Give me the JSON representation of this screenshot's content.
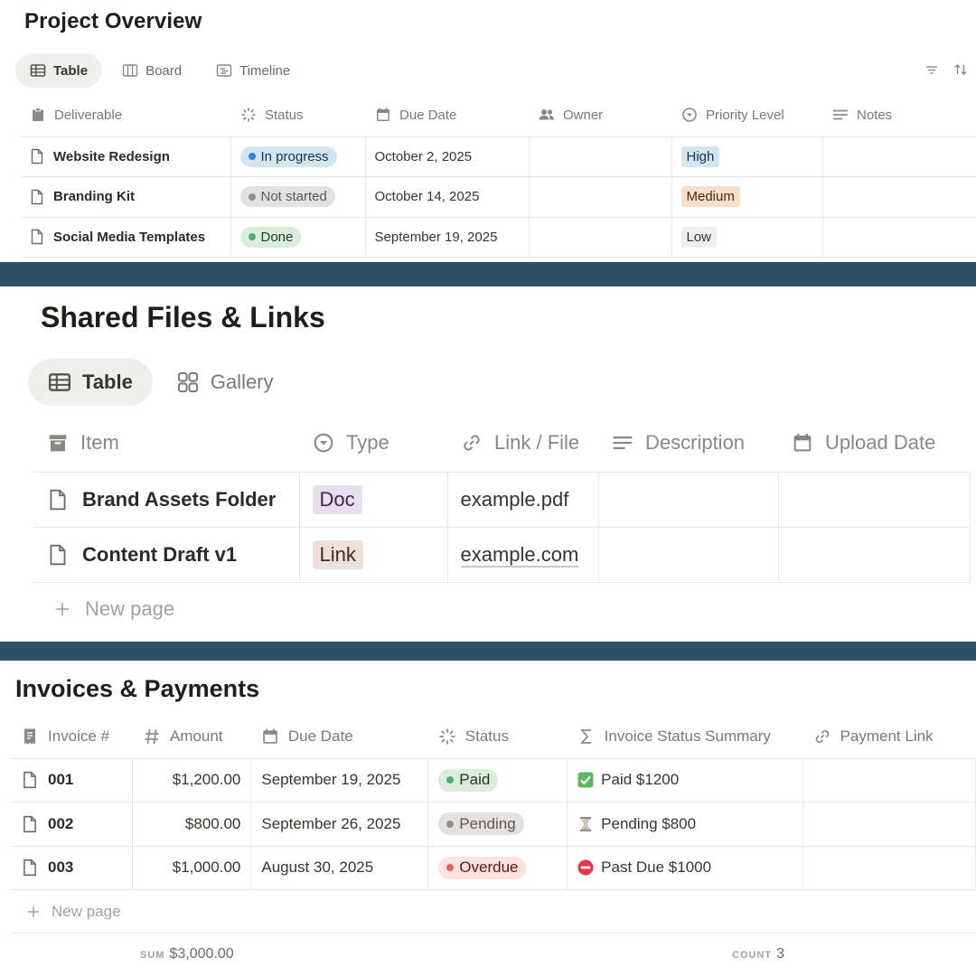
{
  "project_overview": {
    "title": "Project Overview",
    "views": [
      {
        "label": "Table",
        "icon": "table-icon",
        "active": true
      },
      {
        "label": "Board",
        "icon": "board-icon",
        "active": false
      },
      {
        "label": "Timeline",
        "icon": "timeline-icon",
        "active": false
      }
    ],
    "columns": [
      {
        "label": "Deliverable",
        "icon": "clipboard-icon"
      },
      {
        "label": "Status",
        "icon": "status-icon"
      },
      {
        "label": "Due Date",
        "icon": "calendar-icon"
      },
      {
        "label": "Owner",
        "icon": "people-icon"
      },
      {
        "label": "Priority Level",
        "icon": "select-icon"
      },
      {
        "label": "Notes",
        "icon": "text-icon"
      }
    ],
    "rows": [
      {
        "deliverable": "Website Redesign",
        "status": "In progress",
        "status_color": "#2383e2",
        "status_bg": "#d3e5ef",
        "due": "October 2, 2025",
        "owner": "",
        "priority": "High",
        "priority_bg": "#d3e5ef",
        "notes": ""
      },
      {
        "deliverable": "Branding Kit",
        "status": "Not started",
        "status_color": "#91918e",
        "status_bg": "#e3e2e0",
        "due": "October 14, 2025",
        "owner": "",
        "priority": "Medium",
        "priority_bg": "#fadec9",
        "notes": ""
      },
      {
        "deliverable": "Social Media Templates",
        "status": "Done",
        "status_color": "#4dab76",
        "status_bg": "#dbeddb",
        "due": "September 19, 2025",
        "owner": "",
        "priority": "Low",
        "priority_bg": "#eeeeec",
        "notes": ""
      }
    ]
  },
  "shared_files": {
    "title": "Shared Files & Links",
    "views": [
      {
        "label": "Table",
        "icon": "table-icon",
        "active": true
      },
      {
        "label": "Gallery",
        "icon": "gallery-icon",
        "active": false
      }
    ],
    "columns": [
      {
        "label": "Item",
        "icon": "archive-icon"
      },
      {
        "label": "Type",
        "icon": "select-icon"
      },
      {
        "label": "Link / File",
        "icon": "link-icon"
      },
      {
        "label": "Description",
        "icon": "text-icon"
      },
      {
        "label": "Upload Date",
        "icon": "calendar-icon"
      }
    ],
    "rows": [
      {
        "item": "Brand Assets Folder",
        "type": "Doc",
        "type_bg": "#e8deee",
        "link": "example.pdf",
        "description": "",
        "upload_date": ""
      },
      {
        "item": "Content Draft v1",
        "type": "Link",
        "type_bg": "#eee0da",
        "link": "example.com",
        "description": "",
        "upload_date": ""
      }
    ],
    "new_page_label": "New page"
  },
  "invoices": {
    "title": "Invoices & Payments",
    "columns": [
      {
        "label": "Invoice #",
        "icon": "receipt-icon"
      },
      {
        "label": "Amount",
        "icon": "hash-icon"
      },
      {
        "label": "Due Date",
        "icon": "calendar-icon"
      },
      {
        "label": "Status",
        "icon": "status-icon"
      },
      {
        "label": "Invoice Status Summary",
        "icon": "sigma-icon"
      },
      {
        "label": "Payment Link",
        "icon": "link-icon"
      }
    ],
    "rows": [
      {
        "invoice": "001",
        "amount": "$1,200.00",
        "due": "September 19, 2025",
        "status": "Paid",
        "status_color": "#4dab76",
        "status_bg": "#dbeddb",
        "summary": "Paid $1200",
        "summary_icon": "check-emoji-icon",
        "payment_link": ""
      },
      {
        "invoice": "002",
        "amount": "$800.00",
        "due": "September 26, 2025",
        "status": "Pending",
        "status_color": "#91918e",
        "status_bg": "#e3e2e0",
        "summary": "Pending $800",
        "summary_icon": "hourglass-emoji-icon",
        "payment_link": ""
      },
      {
        "invoice": "003",
        "amount": "$1,000.00",
        "due": "August 30, 2025",
        "status": "Overdue",
        "status_color": "#e16259",
        "status_bg": "#ffe2dd",
        "summary": "Past Due $1000",
        "summary_icon": "no-entry-emoji-icon",
        "payment_link": ""
      }
    ],
    "new_page_label": "New page",
    "sum_label": "SUM",
    "sum_value": "$3,000.00",
    "count_label": "COUNT",
    "count_value": "3"
  },
  "colors": {
    "divider": "#2f5168",
    "border": "#e9e9e7"
  }
}
